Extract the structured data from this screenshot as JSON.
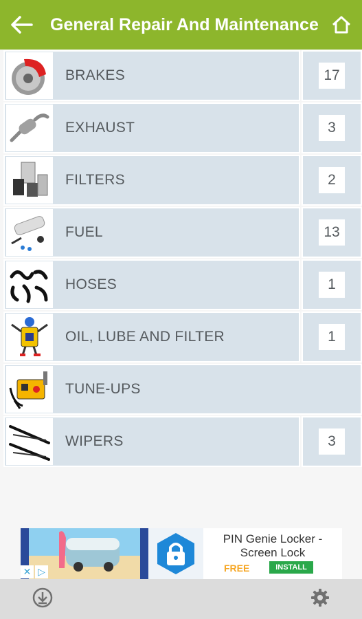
{
  "header": {
    "title": "General Repair And Maintenance",
    "back_icon": "arrow-left-icon",
    "home_icon": "home-icon",
    "color": "#8db62c"
  },
  "categories": [
    {
      "label": "BRAKES",
      "count": "17",
      "icon": "brake-disc-icon"
    },
    {
      "label": "EXHAUST",
      "count": "3",
      "icon": "exhaust-pipe-icon"
    },
    {
      "label": "FILTERS",
      "count": "2",
      "icon": "filters-icon"
    },
    {
      "label": "FUEL",
      "count": "13",
      "icon": "fuel-pump-icon"
    },
    {
      "label": "HOSES",
      "count": "1",
      "icon": "hoses-icon"
    },
    {
      "label": "OIL, LUBE AND FILTER",
      "count": "1",
      "icon": "oil-can-mascot-icon"
    },
    {
      "label": "TUNE-UPS",
      "count": "",
      "icon": "tune-up-kit-icon"
    },
    {
      "label": "WIPERS",
      "count": "3",
      "icon": "wiper-blades-icon"
    }
  ],
  "ad": {
    "title": "PIN Genie Locker - Screen Lock",
    "free_label": "FREE",
    "install_label": "INSTALL",
    "icon": "padlock-icon",
    "marks": [
      "✕",
      "▷"
    ]
  },
  "bottom_bar": {
    "left_icon": "download-icon",
    "right_icon": "gear-icon"
  }
}
